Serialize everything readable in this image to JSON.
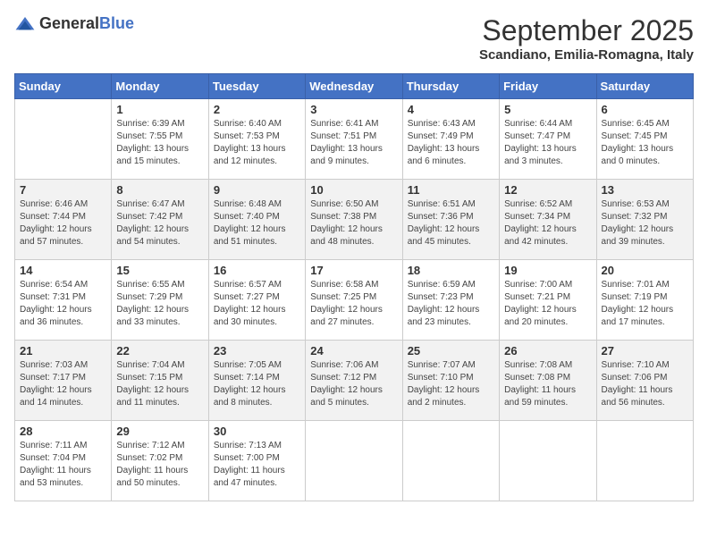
{
  "header": {
    "logo_general": "General",
    "logo_blue": "Blue",
    "month_title": "September 2025",
    "subtitle": "Scandiano, Emilia-Romagna, Italy"
  },
  "days_of_week": [
    "Sunday",
    "Monday",
    "Tuesday",
    "Wednesday",
    "Thursday",
    "Friday",
    "Saturday"
  ],
  "weeks": [
    [
      {
        "day": "",
        "sunrise": "",
        "sunset": "",
        "daylight": ""
      },
      {
        "day": "1",
        "sunrise": "Sunrise: 6:39 AM",
        "sunset": "Sunset: 7:55 PM",
        "daylight": "Daylight: 13 hours and 15 minutes."
      },
      {
        "day": "2",
        "sunrise": "Sunrise: 6:40 AM",
        "sunset": "Sunset: 7:53 PM",
        "daylight": "Daylight: 13 hours and 12 minutes."
      },
      {
        "day": "3",
        "sunrise": "Sunrise: 6:41 AM",
        "sunset": "Sunset: 7:51 PM",
        "daylight": "Daylight: 13 hours and 9 minutes."
      },
      {
        "day": "4",
        "sunrise": "Sunrise: 6:43 AM",
        "sunset": "Sunset: 7:49 PM",
        "daylight": "Daylight: 13 hours and 6 minutes."
      },
      {
        "day": "5",
        "sunrise": "Sunrise: 6:44 AM",
        "sunset": "Sunset: 7:47 PM",
        "daylight": "Daylight: 13 hours and 3 minutes."
      },
      {
        "day": "6",
        "sunrise": "Sunrise: 6:45 AM",
        "sunset": "Sunset: 7:45 PM",
        "daylight": "Daylight: 13 hours and 0 minutes."
      }
    ],
    [
      {
        "day": "7",
        "sunrise": "Sunrise: 6:46 AM",
        "sunset": "Sunset: 7:44 PM",
        "daylight": "Daylight: 12 hours and 57 minutes."
      },
      {
        "day": "8",
        "sunrise": "Sunrise: 6:47 AM",
        "sunset": "Sunset: 7:42 PM",
        "daylight": "Daylight: 12 hours and 54 minutes."
      },
      {
        "day": "9",
        "sunrise": "Sunrise: 6:48 AM",
        "sunset": "Sunset: 7:40 PM",
        "daylight": "Daylight: 12 hours and 51 minutes."
      },
      {
        "day": "10",
        "sunrise": "Sunrise: 6:50 AM",
        "sunset": "Sunset: 7:38 PM",
        "daylight": "Daylight: 12 hours and 48 minutes."
      },
      {
        "day": "11",
        "sunrise": "Sunrise: 6:51 AM",
        "sunset": "Sunset: 7:36 PM",
        "daylight": "Daylight: 12 hours and 45 minutes."
      },
      {
        "day": "12",
        "sunrise": "Sunrise: 6:52 AM",
        "sunset": "Sunset: 7:34 PM",
        "daylight": "Daylight: 12 hours and 42 minutes."
      },
      {
        "day": "13",
        "sunrise": "Sunrise: 6:53 AM",
        "sunset": "Sunset: 7:32 PM",
        "daylight": "Daylight: 12 hours and 39 minutes."
      }
    ],
    [
      {
        "day": "14",
        "sunrise": "Sunrise: 6:54 AM",
        "sunset": "Sunset: 7:31 PM",
        "daylight": "Daylight: 12 hours and 36 minutes."
      },
      {
        "day": "15",
        "sunrise": "Sunrise: 6:55 AM",
        "sunset": "Sunset: 7:29 PM",
        "daylight": "Daylight: 12 hours and 33 minutes."
      },
      {
        "day": "16",
        "sunrise": "Sunrise: 6:57 AM",
        "sunset": "Sunset: 7:27 PM",
        "daylight": "Daylight: 12 hours and 30 minutes."
      },
      {
        "day": "17",
        "sunrise": "Sunrise: 6:58 AM",
        "sunset": "Sunset: 7:25 PM",
        "daylight": "Daylight: 12 hours and 27 minutes."
      },
      {
        "day": "18",
        "sunrise": "Sunrise: 6:59 AM",
        "sunset": "Sunset: 7:23 PM",
        "daylight": "Daylight: 12 hours and 23 minutes."
      },
      {
        "day": "19",
        "sunrise": "Sunrise: 7:00 AM",
        "sunset": "Sunset: 7:21 PM",
        "daylight": "Daylight: 12 hours and 20 minutes."
      },
      {
        "day": "20",
        "sunrise": "Sunrise: 7:01 AM",
        "sunset": "Sunset: 7:19 PM",
        "daylight": "Daylight: 12 hours and 17 minutes."
      }
    ],
    [
      {
        "day": "21",
        "sunrise": "Sunrise: 7:03 AM",
        "sunset": "Sunset: 7:17 PM",
        "daylight": "Daylight: 12 hours and 14 minutes."
      },
      {
        "day": "22",
        "sunrise": "Sunrise: 7:04 AM",
        "sunset": "Sunset: 7:15 PM",
        "daylight": "Daylight: 12 hours and 11 minutes."
      },
      {
        "day": "23",
        "sunrise": "Sunrise: 7:05 AM",
        "sunset": "Sunset: 7:14 PM",
        "daylight": "Daylight: 12 hours and 8 minutes."
      },
      {
        "day": "24",
        "sunrise": "Sunrise: 7:06 AM",
        "sunset": "Sunset: 7:12 PM",
        "daylight": "Daylight: 12 hours and 5 minutes."
      },
      {
        "day": "25",
        "sunrise": "Sunrise: 7:07 AM",
        "sunset": "Sunset: 7:10 PM",
        "daylight": "Daylight: 12 hours and 2 minutes."
      },
      {
        "day": "26",
        "sunrise": "Sunrise: 7:08 AM",
        "sunset": "Sunset: 7:08 PM",
        "daylight": "Daylight: 11 hours and 59 minutes."
      },
      {
        "day": "27",
        "sunrise": "Sunrise: 7:10 AM",
        "sunset": "Sunset: 7:06 PM",
        "daylight": "Daylight: 11 hours and 56 minutes."
      }
    ],
    [
      {
        "day": "28",
        "sunrise": "Sunrise: 7:11 AM",
        "sunset": "Sunset: 7:04 PM",
        "daylight": "Daylight: 11 hours and 53 minutes."
      },
      {
        "day": "29",
        "sunrise": "Sunrise: 7:12 AM",
        "sunset": "Sunset: 7:02 PM",
        "daylight": "Daylight: 11 hours and 50 minutes."
      },
      {
        "day": "30",
        "sunrise": "Sunrise: 7:13 AM",
        "sunset": "Sunset: 7:00 PM",
        "daylight": "Daylight: 11 hours and 47 minutes."
      },
      {
        "day": "",
        "sunrise": "",
        "sunset": "",
        "daylight": ""
      },
      {
        "day": "",
        "sunrise": "",
        "sunset": "",
        "daylight": ""
      },
      {
        "day": "",
        "sunrise": "",
        "sunset": "",
        "daylight": ""
      },
      {
        "day": "",
        "sunrise": "",
        "sunset": "",
        "daylight": ""
      }
    ]
  ]
}
